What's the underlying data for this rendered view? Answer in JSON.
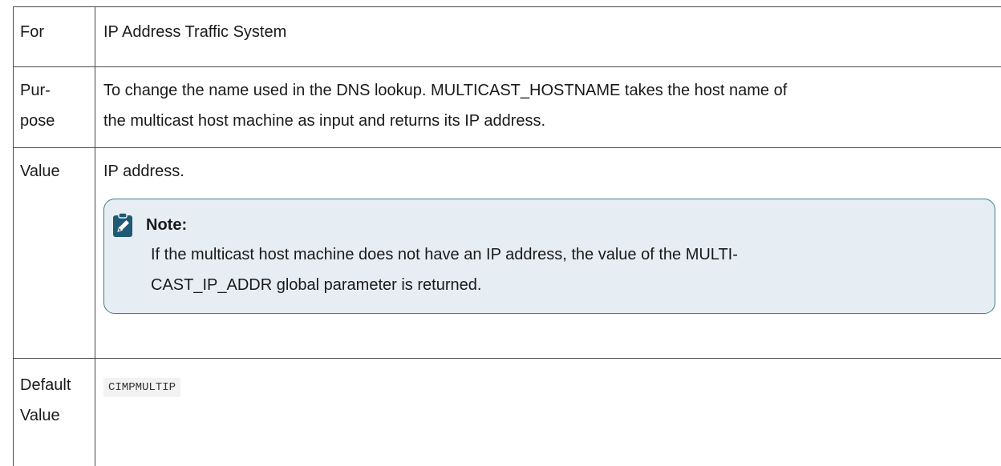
{
  "table": {
    "rows": [
      {
        "label": "For",
        "value": "IP Address Traffic System"
      },
      {
        "label_lines": [
          "Pur-",
          "pose"
        ],
        "value_lines": [
          "To change the name used in the DNS lookup. MULTICAST_HOSTNAME takes the host name of",
          "the multicast host machine as input and returns its IP address."
        ]
      },
      {
        "label": "Value",
        "value": "IP address.",
        "note": {
          "icon": "pencil-clipboard-icon",
          "title": "Note:",
          "body_lines": [
            "If the multicast host machine does not have an IP address, the value of the MULTI-",
            "CAST_IP_ADDR global parameter is returned."
          ]
        }
      },
      {
        "label_lines": [
          "Default",
          "Value"
        ],
        "value": "CIMPMULTIP"
      }
    ]
  },
  "colors": {
    "note_background": "#e6eef4",
    "note_border": "#3f7f8f",
    "note_icon": "#1e5a74",
    "table_border": "#4a4a4a"
  }
}
